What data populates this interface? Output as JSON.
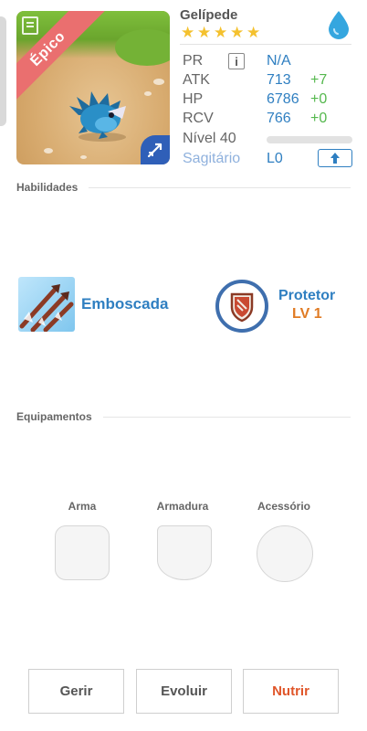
{
  "monster": {
    "name": "Gelípede",
    "rarity": "Épico",
    "stars": 5,
    "element_icon": "water-drop-icon",
    "class_icon": "archer-arrow-icon"
  },
  "stats": {
    "pr": {
      "label": "PR",
      "value": "N/A",
      "info_icon": "i"
    },
    "atk": {
      "label": "ATK",
      "value": "713",
      "bonus": "+7"
    },
    "hp": {
      "label": "HP",
      "value": "6786",
      "bonus": "+0"
    },
    "rcv": {
      "label": "RCV",
      "value": "766",
      "bonus": "+0"
    },
    "level": {
      "label": "Nível 40",
      "progress": 0
    },
    "class": {
      "label": "Sagitário",
      "limit": "L0"
    }
  },
  "sections": {
    "skills_title": "Habilidades",
    "equipment_title": "Equipamentos"
  },
  "skills": [
    {
      "name": "Emboscada"
    },
    {
      "name": "Protetor",
      "level": "LV 1"
    }
  ],
  "equipment": {
    "weapon_label": "Arma",
    "armor_label": "Armadura",
    "accessory_label": "Acessório"
  },
  "actions": {
    "manage": "Gerir",
    "evolve": "Evoluir",
    "feed": "Nutrir"
  },
  "colors": {
    "accent_blue": "#2f7fc1",
    "bonus_green": "#55b84e",
    "rarity_red": "#ea6f6f",
    "feed_orange": "#e0562a",
    "star_gold": "#f4c12e"
  }
}
